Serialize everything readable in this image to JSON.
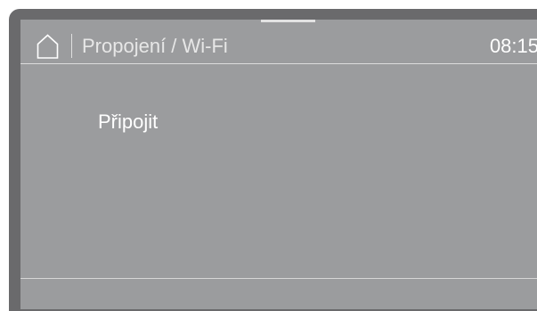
{
  "header": {
    "home_icon": "home-icon",
    "title": "Propojení / Wi-Fi",
    "time": "08:15"
  },
  "menu": {
    "items": [
      {
        "label": "Připojit"
      }
    ]
  },
  "colors": {
    "bezel": "#6a6a6c",
    "screen": "#9b9c9e",
    "text": "#ffffff"
  }
}
